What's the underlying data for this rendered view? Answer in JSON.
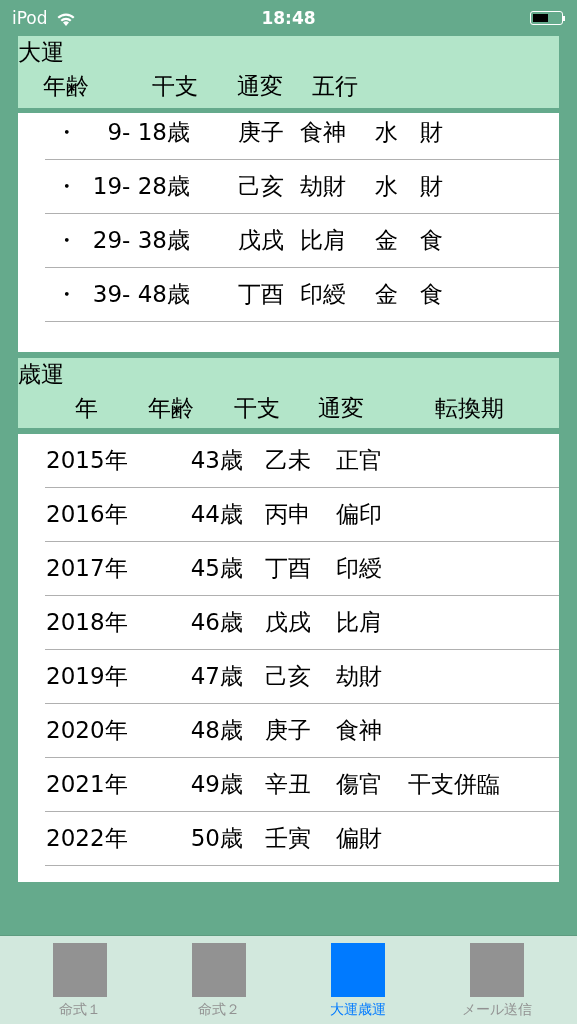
{
  "status_bar": {
    "carrier": "iPod",
    "time": "18:48"
  },
  "daiun": {
    "title": "大運",
    "columns": [
      "年齢",
      "干支",
      "通変",
      "五行"
    ],
    "rows": [
      {
        "bullet": "・",
        "age": "9- 18歳",
        "kanshi": "庚子",
        "tsuhen": "食神",
        "gogyo": "水",
        "column_5": "財"
      },
      {
        "bullet": "・",
        "age": "19- 28歳",
        "kanshi": "己亥",
        "tsuhen": "劫財",
        "gogyo": "水",
        "column_5": "財"
      },
      {
        "bullet": "・",
        "age": "29- 38歳",
        "kanshi": "戊戌",
        "tsuhen": "比肩",
        "gogyo": "金",
        "column_5": "食"
      },
      {
        "bullet": "・",
        "age": "39- 48歳",
        "kanshi": "丁酉",
        "tsuhen": "印綬",
        "gogyo": "金",
        "column_5": "食"
      }
    ]
  },
  "saiun": {
    "title": "歳運",
    "columns": [
      "年",
      "年齢",
      "干支",
      "通変",
      "転換期"
    ],
    "rows": [
      {
        "year": "2015年",
        "age": "43歳",
        "kanshi": "乙未",
        "tsuhen": "正官"
      },
      {
        "year": "2016年",
        "age": "44歳",
        "kanshi": "丙申",
        "tsuhen": "偏印"
      },
      {
        "year": "2017年",
        "age": "45歳",
        "kanshi": "丁酉",
        "tsuhen": "印綬"
      },
      {
        "year": "2018年",
        "age": "46歳",
        "kanshi": "戊戌",
        "tsuhen": "比肩"
      },
      {
        "year": "2019年",
        "age": "47歳",
        "kanshi": "己亥",
        "tsuhen": "劫財"
      },
      {
        "year": "2020年",
        "age": "48歳",
        "kanshi": "庚子",
        "tsuhen": "食神"
      },
      {
        "year": "2021年",
        "age": "49歳",
        "kanshi": "辛丑",
        "tsuhen": "傷官",
        "tenkanki": "干支併臨"
      },
      {
        "year": "2022年",
        "age": "50歳",
        "kanshi": "壬寅",
        "tsuhen": "偏財"
      }
    ]
  },
  "tabs": [
    {
      "label": "命式１",
      "selected": false
    },
    {
      "label": "命式２",
      "selected": false
    },
    {
      "label": "大運歳運",
      "selected": true
    },
    {
      "label": "メール送信",
      "selected": false
    }
  ]
}
